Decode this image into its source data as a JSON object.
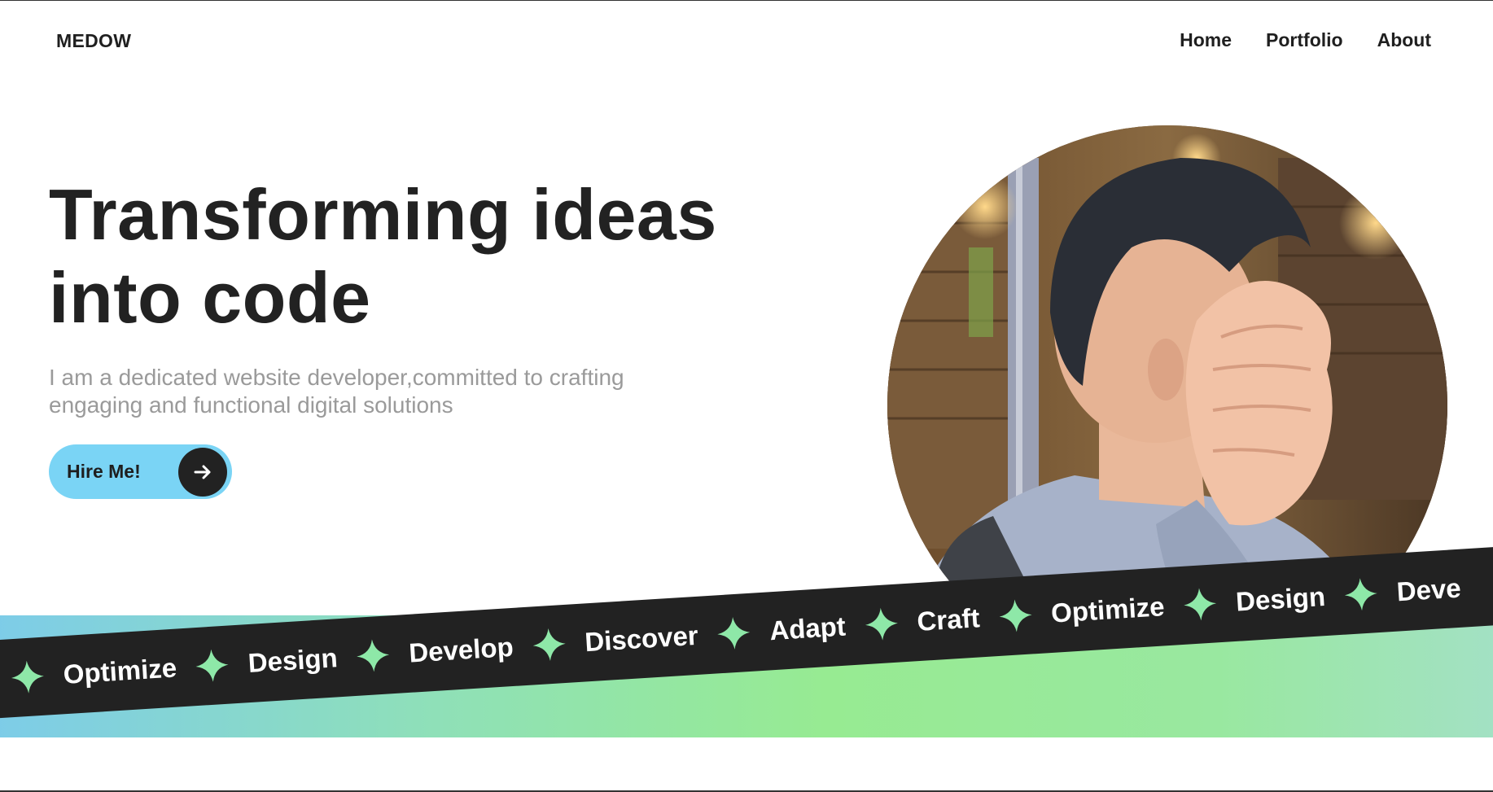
{
  "header": {
    "logo": "MEDOW",
    "nav": [
      {
        "label": "Home"
      },
      {
        "label": "Portfolio"
      },
      {
        "label": "About"
      }
    ]
  },
  "hero": {
    "headline_line1": "Transforming ideas",
    "headline_line2": "into code",
    "subtext": "I am a dedicated website developer,committed to crafting engaging and functional digital solutions",
    "cta_label": "Hire Me!",
    "cta_icon": "arrow-right-icon"
  },
  "band": {
    "words": [
      "Optimize",
      "Design",
      "Develop",
      "Discover",
      "Adapt",
      "Craft",
      "Optimize",
      "Design",
      "Deve"
    ],
    "star_icon": "four-point-star-icon",
    "star_color": "#8ee8a8",
    "dark_color": "#222222"
  },
  "colors": {
    "accent": "#7ad4f5",
    "text": "#222222",
    "muted": "#9a9a9a"
  }
}
